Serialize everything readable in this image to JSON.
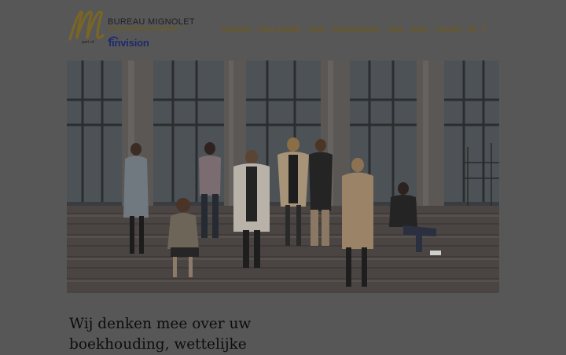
{
  "brand": {
    "name": "BUREAU MIGNOLET",
    "tagline": "TAX ADVISORS AND ACCOUNTANTS",
    "part_of": "part of",
    "parent": "finvision"
  },
  "nav": {
    "items": [
      {
        "label": "Diensten"
      },
      {
        "label": "Onze aanpak"
      },
      {
        "label": "Team"
      },
      {
        "label": "Getuigenissen"
      },
      {
        "label": "Jobs"
      },
      {
        "label": "Links"
      },
      {
        "label": "Contact"
      }
    ],
    "language": "NL"
  },
  "hero": {
    "image": "team-photo"
  },
  "headline": {
    "line1": "Wij denken mee over uw",
    "line2": "boekhouding, wettelijke"
  },
  "colors": {
    "overlay": "#575757",
    "accent": "#6e5a1c",
    "parent_brand": "#1d2a6e"
  }
}
